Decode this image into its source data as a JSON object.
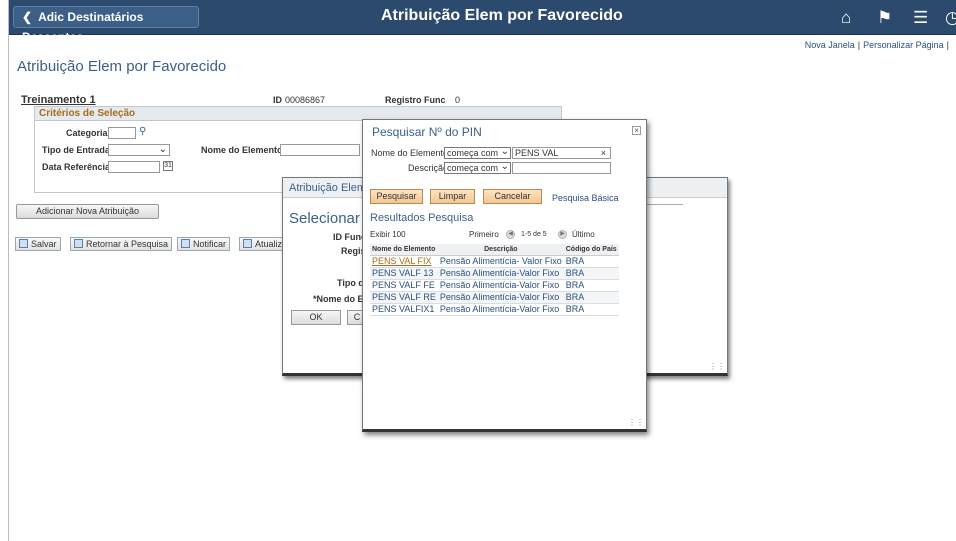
{
  "header": {
    "back_label": "Adic Destinatários Descontos",
    "title": "Atribuição Elem por Favorecido",
    "icons": [
      "home-icon",
      "flag-icon",
      "menu-icon",
      "navbar-icon"
    ]
  },
  "top_links": {
    "new_window": "Nova Janela",
    "personalize": "Personalizar Página"
  },
  "page_title": "Atribuição Elem por Favorecido",
  "info": {
    "name": "Treinamento 1",
    "id_label": "ID",
    "id_value": "00086867",
    "reg_label": "Registro Func",
    "reg_value": "0"
  },
  "criteria": {
    "title": "Critérios de Seleção",
    "category_label": "Categoria",
    "entry_type_label": "Tipo de Entrada",
    "ref_date_label": "Data Referência",
    "element_name_label": "Nome do Elemento"
  },
  "buttons": {
    "add_new": "Adicionar Nova Atribuição",
    "save": "Salvar",
    "return_search": "Retornar à Pesquisa",
    "notify": "Notificar",
    "update": "Atualiza"
  },
  "modal_bg": {
    "title": "Atribuição Elem",
    "heading": "Selecionar u",
    "id_label": "ID Func",
    "reg_label": "Regist",
    "type_label": "Tipo de",
    "name_label": "*Nome do El",
    "ok": "OK",
    "cancel_partial": "C"
  },
  "search_modal": {
    "title": "Pesquisar Nº do PIN",
    "close": "×",
    "field1_label": "Nome do Elemento",
    "field1_op": "começa com",
    "field1_value": "PENS VAL",
    "field1_clear": "×",
    "field2_label": "Descrição",
    "field2_op": "começa com",
    "field2_value": "",
    "search_btn": "Pesquisar",
    "clear_btn": "Limpar",
    "cancel_btn": "Cancelar",
    "basic_link": "Pesquisa Básica",
    "results_title": "Resultados Pesquisa",
    "show_label": "Exibir 100",
    "first_label": "Primeiro",
    "range_label": "1-5 de 5",
    "last_label": "Último",
    "columns": [
      "Nome do Elemento",
      "Descrição",
      "Código do País"
    ],
    "rows": [
      [
        "PENS VAL FIX",
        "Pensão Alimentícia- Valor Fixo",
        "BRA"
      ],
      [
        "PENS VALF 13",
        "Pensão Alimentícia-Valor Fixo",
        "BRA"
      ],
      [
        "PENS VALF FE",
        "Pensão Alimentícia-Valor Fixo",
        "BRA"
      ],
      [
        "PENS VALF RE",
        "Pensão Alimentícia-Valor Fixo",
        "BRA"
      ],
      [
        "PENS VALFIX1",
        "Pensão Alimentícia-Valor Fixo",
        "BRA"
      ]
    ]
  }
}
